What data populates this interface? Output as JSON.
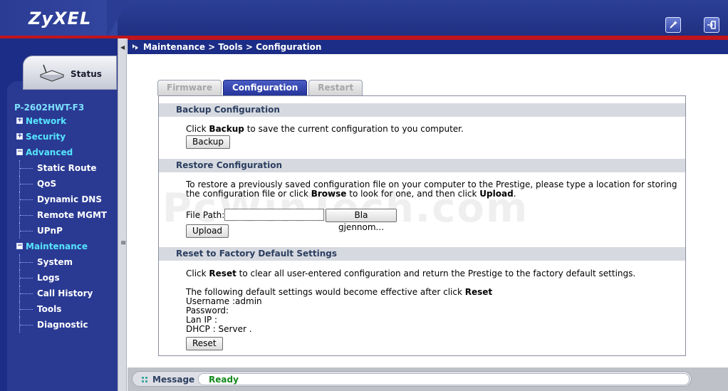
{
  "app": {
    "brand": "ZyXEL",
    "model": "P-2602HWT-F3"
  },
  "header": {
    "wizard_icon": "wizard-icon",
    "logout_icon": "logout-icon"
  },
  "sidebar": {
    "status_label": "Status",
    "items": [
      {
        "label": "Network",
        "type": "group",
        "expanded": false
      },
      {
        "label": "Security",
        "type": "group",
        "expanded": false
      },
      {
        "label": "Advanced",
        "type": "group",
        "expanded": true
      },
      {
        "label": "Static Route",
        "type": "child"
      },
      {
        "label": "QoS",
        "type": "child"
      },
      {
        "label": "Dynamic DNS",
        "type": "child"
      },
      {
        "label": "Remote MGMT",
        "type": "child"
      },
      {
        "label": "UPnP",
        "type": "child"
      },
      {
        "label": "Maintenance",
        "type": "group",
        "expanded": true
      },
      {
        "label": "System",
        "type": "child"
      },
      {
        "label": "Logs",
        "type": "child"
      },
      {
        "label": "Call History",
        "type": "child"
      },
      {
        "label": "Tools",
        "type": "child"
      },
      {
        "label": "Diagnostic",
        "type": "child"
      }
    ]
  },
  "breadcrumb": "Maintenance > Tools > Configuration",
  "tabs": [
    {
      "label": "Firmware",
      "active": false
    },
    {
      "label": "Configuration",
      "active": true
    },
    {
      "label": "Restart",
      "active": false
    }
  ],
  "backup": {
    "title": "Backup Configuration",
    "text_pre": "Click ",
    "text_bold": "Backup",
    "text_post": " to save the current configuration to you computer.",
    "button": "Backup"
  },
  "restore": {
    "title": "Restore Configuration",
    "line1": "To restore a previously saved configuration file on your computer to the Prestige, please type a location for storing",
    "line2_pre": "the configuration file or click ",
    "line2_bold1": "Browse",
    "line2_mid": " to look for one, and then click ",
    "line2_bold2": "Upload",
    "line2_post": ".",
    "file_path_label": "File Path:",
    "file_path_value": "",
    "browse_button": "Bla gjennom...",
    "upload_button": "Upload"
  },
  "reset": {
    "title": "Reset to Factory Default Settings",
    "text_pre": "Click ",
    "text_bold": "Reset",
    "text_post": " to clear all user-entered configuration and return the Prestige to the factory default settings.",
    "defaults_pre": "The following default settings would become effective after click ",
    "defaults_bold": "Reset",
    "username": "Username :admin",
    "password": "Password:",
    "lan_ip": "Lan IP :",
    "dhcp": "DHCP : Server .",
    "button": "Reset"
  },
  "watermark": "PcWinTech.com",
  "message": {
    "label": "Message",
    "value": "Ready",
    "value_color": "#138a1c"
  }
}
